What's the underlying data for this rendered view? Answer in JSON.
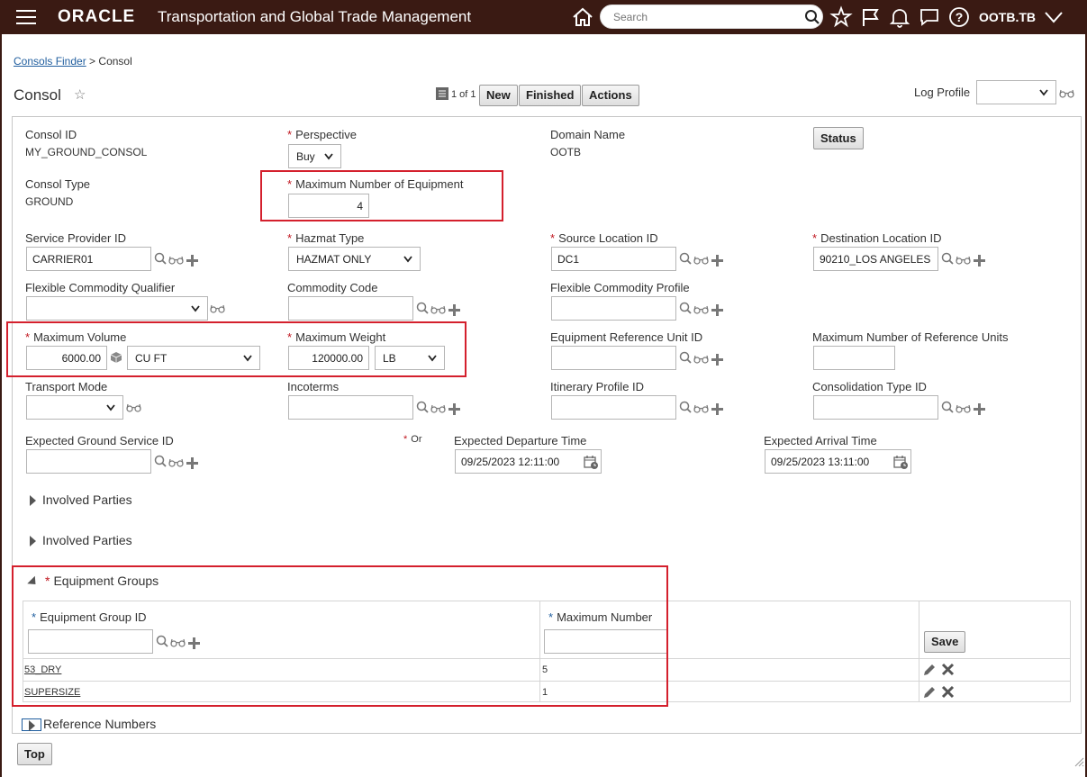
{
  "header": {
    "brand": "ORACLE",
    "app_title": "Transportation and Global Trade Management",
    "search_placeholder": "Search",
    "user": "OOTB.TB"
  },
  "breadcrumb": {
    "parent": "Consols Finder",
    "separator": ">",
    "current": "Consol"
  },
  "page": {
    "title": "Consol",
    "pager": "1 of 1"
  },
  "toolbar": {
    "new": "New",
    "finished": "Finished",
    "actions": "Actions"
  },
  "log_profile": {
    "label": "Log Profile",
    "value": ""
  },
  "form": {
    "consol_id": {
      "label": "Consol ID",
      "value": "MY_GROUND_CONSOL"
    },
    "perspective": {
      "label": "Perspective",
      "value": "Buy"
    },
    "domain_name": {
      "label": "Domain Name",
      "value": "OOTB"
    },
    "status_button": "Status",
    "consol_type": {
      "label": "Consol Type",
      "value": "GROUND"
    },
    "max_num_equipment": {
      "label": "Maximum Number of Equipment",
      "value": "4"
    },
    "service_provider_id": {
      "label": "Service Provider ID",
      "value": "CARRIER01"
    },
    "hazmat_type": {
      "label": "Hazmat Type",
      "value": "HAZMAT ONLY"
    },
    "source_location_id": {
      "label": "Source Location ID",
      "value": "DC1"
    },
    "destination_location_id": {
      "label": "Destination Location ID",
      "value": "90210_LOS ANGELES"
    },
    "flexible_commodity_qualifier": {
      "label": "Flexible Commodity Qualifier",
      "value": ""
    },
    "commodity_code": {
      "label": "Commodity Code",
      "value": ""
    },
    "flexible_commodity_profile": {
      "label": "Flexible Commodity Profile",
      "value": ""
    },
    "maximum_volume": {
      "label": "Maximum Volume",
      "value": "6000.00",
      "unit": "CU FT"
    },
    "maximum_weight": {
      "label": "Maximum Weight",
      "value": "120000.00",
      "unit": "LB"
    },
    "equipment_reference_unit_id": {
      "label": "Equipment Reference Unit ID",
      "value": ""
    },
    "max_num_reference_units": {
      "label": "Maximum Number of Reference Units",
      "value": ""
    },
    "transport_mode": {
      "label": "Transport Mode",
      "value": ""
    },
    "incoterms": {
      "label": "Incoterms",
      "value": ""
    },
    "itinerary_profile_id": {
      "label": "Itinerary Profile ID",
      "value": ""
    },
    "consolidation_type_id": {
      "label": "Consolidation Type ID",
      "value": ""
    },
    "expected_ground_service_id": {
      "label": "Expected Ground Service ID",
      "value": ""
    },
    "or_label": "Or",
    "expected_departure_time": {
      "label": "Expected Departure Time",
      "value": "09/25/2023 12:11:00"
    },
    "expected_arrival_time": {
      "label": "Expected Arrival Time",
      "value": "09/25/2023 13:11:00"
    }
  },
  "sections": {
    "involved_parties_1": "Involved Parties",
    "involved_parties_2": "Involved Parties",
    "equipment_groups": "Equipment Groups",
    "reference_numbers": "Reference Numbers"
  },
  "equipment_table": {
    "col_group_id": "Equipment Group ID",
    "col_max_number": "Maximum Number",
    "save": "Save",
    "rows": [
      {
        "group_id": "53_DRY",
        "max_number": "5"
      },
      {
        "group_id": "SUPERSIZE",
        "max_number": "1"
      }
    ]
  },
  "footer": {
    "top_button": "Top"
  },
  "colors": {
    "header_bg": "#3a1a13",
    "highlight": "#d4202d",
    "required": "#c0161f",
    "link": "#1f5d9e"
  }
}
